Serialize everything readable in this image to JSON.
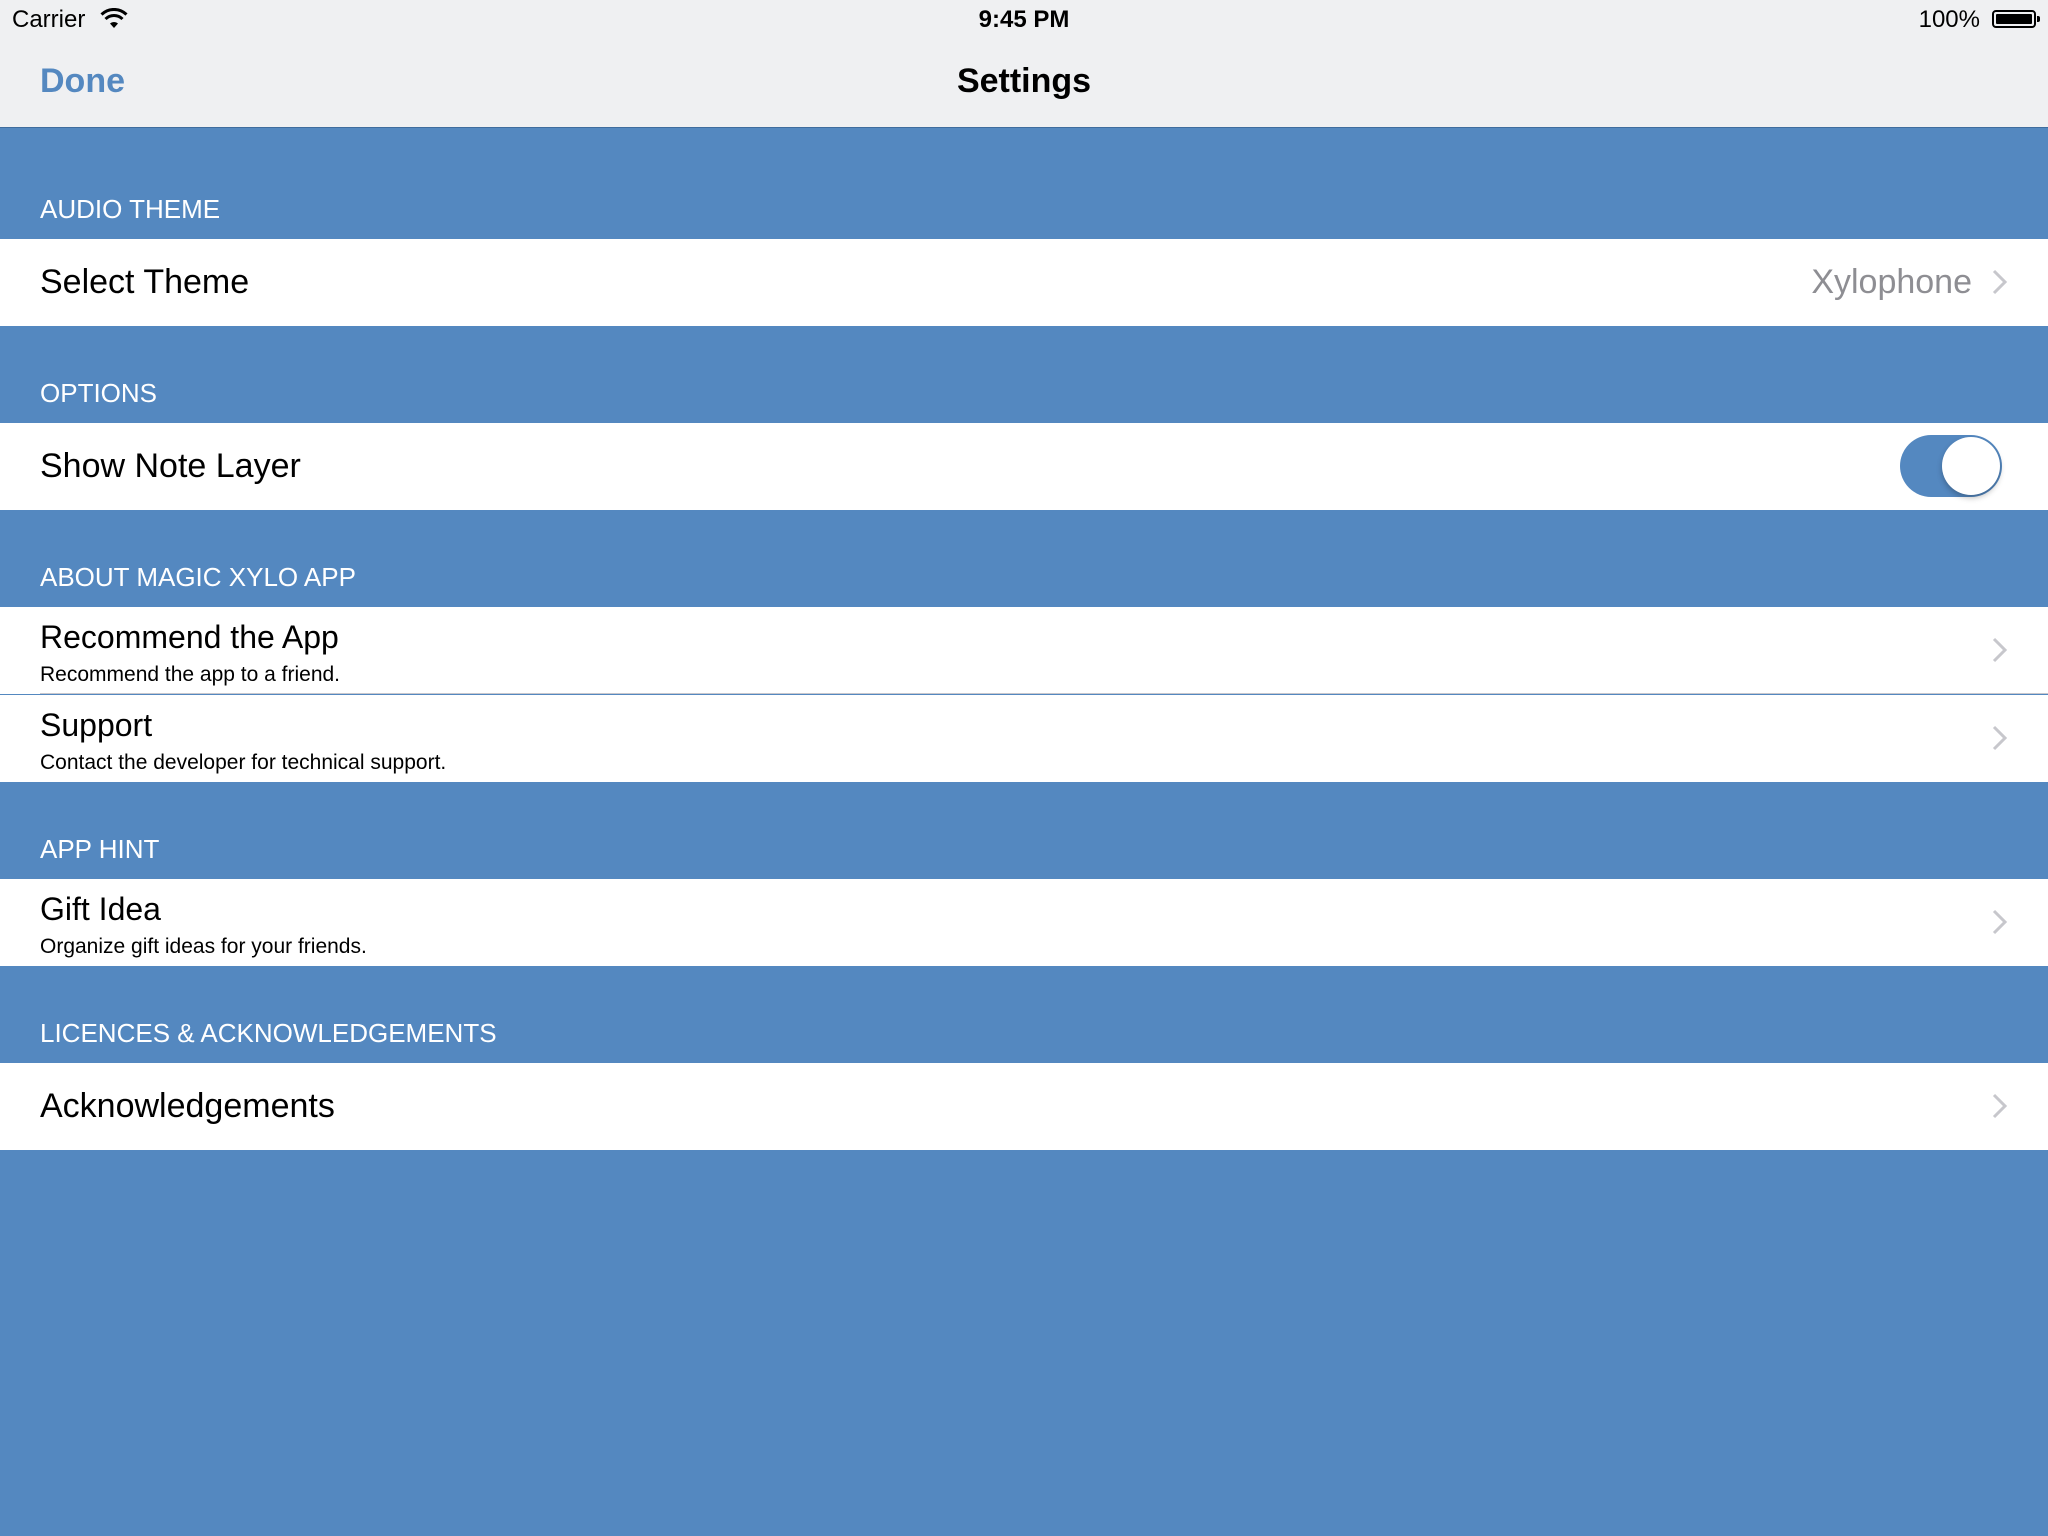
{
  "status_bar": {
    "carrier": "Carrier",
    "wifi_icon": "wifi-icon",
    "time": "9:45 PM",
    "battery_percent": "100%",
    "battery_icon": "battery-icon"
  },
  "nav_bar": {
    "done_label": "Done",
    "title": "Settings"
  },
  "colors": {
    "accent": "#5488c0",
    "background": "#5488c0",
    "bar_background": "#eff0f2",
    "secondary_text": "#8e8e93",
    "separator": "#c8c7cc"
  },
  "sections": [
    {
      "header": "AUDIO THEME",
      "rows": [
        {
          "label": "Select Theme",
          "value": "Xylophone",
          "accessory": "chevron-right-icon"
        }
      ]
    },
    {
      "header": "OPTIONS",
      "rows": [
        {
          "label": "Show Note Layer",
          "toggle_on": true
        }
      ]
    },
    {
      "header": "ABOUT MAGIC XYLO APP",
      "rows": [
        {
          "label": "Recommend the App",
          "subtitle": "Recommend the app to a friend.",
          "accessory": "chevron-right-icon"
        },
        {
          "label": "Support",
          "subtitle": "Contact the developer for technical support.",
          "accessory": "chevron-right-icon"
        }
      ]
    },
    {
      "header": "APP HINT",
      "rows": [
        {
          "label": "Gift Idea",
          "subtitle": "Organize gift ideas for your friends.",
          "accessory": "chevron-right-icon"
        }
      ]
    },
    {
      "header": "LICENCES & ACKNOWLEDGEMENTS",
      "rows": [
        {
          "label": "Acknowledgements",
          "accessory": "chevron-right-icon"
        }
      ]
    }
  ]
}
